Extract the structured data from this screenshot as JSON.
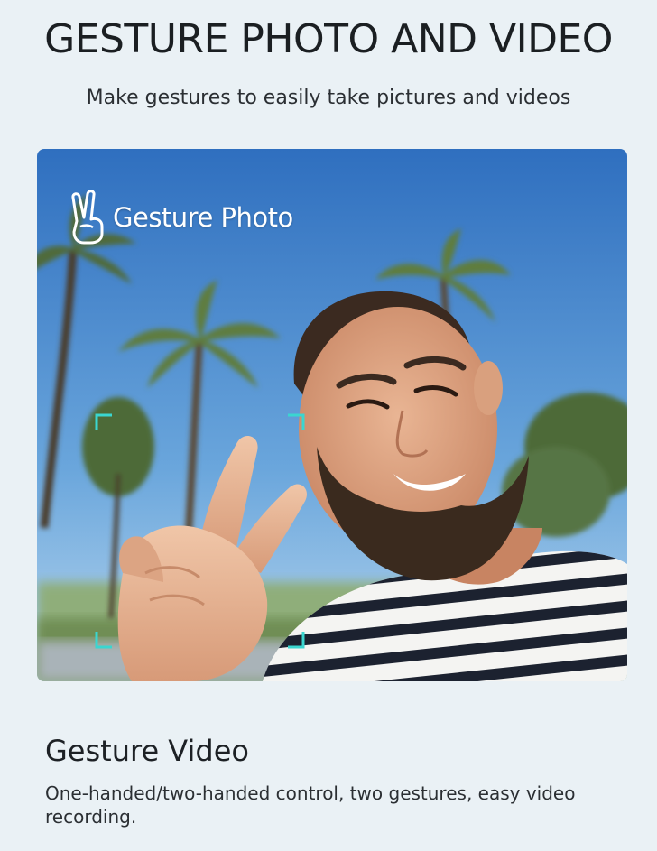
{
  "header": {
    "title": "GESTURE PHOTO AND VIDEO",
    "subtitle": "Make gestures to easily take pictures and videos"
  },
  "photo": {
    "overlay_label": "Gesture Photo",
    "overlay_icon": "peace-hand-icon",
    "scene": "man smiling making peace sign with palm trees and blue sky"
  },
  "section": {
    "title": "Gesture Video",
    "description": "One-handed/two-handed control, two gestures, easy video recording."
  },
  "colors": {
    "page_background": "#eaf1f5",
    "focus_frame": "#3ad6d0",
    "sky_top": "#2f6fbf",
    "sky_bottom": "#9ec8ea"
  }
}
